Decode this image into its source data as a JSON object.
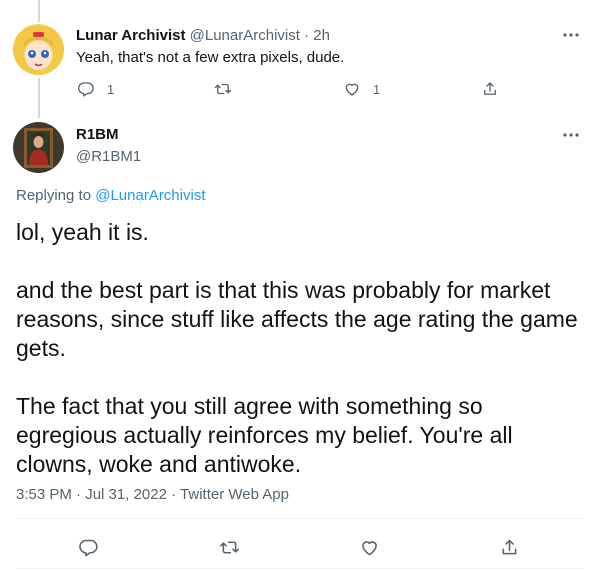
{
  "reply_tweet": {
    "display_name": "Lunar Archivist",
    "handle": "@LunarArchivist",
    "dot": "·",
    "time": "2h",
    "text": "Yeah, that's not a few extra pixels, dude.",
    "reply_count": "1",
    "like_count": "1",
    "avatar_icon": "anime-character-avatar"
  },
  "main_tweet": {
    "display_name": "R1BM",
    "handle": "@R1BM1",
    "replying_prefix": "Replying to",
    "replying_handle": "@LunarArchivist",
    "paragraphs": [
      "lol, yeah it is.",
      "and the best part is that this was probably for market reasons, since stuff like affects the age rating the game gets.",
      "The fact that you still agree with something so egregious actually reinforces my belief. You're all clowns, woke and antiwoke."
    ],
    "time": "3:53 PM",
    "date": "Jul 31, 2022",
    "source": "Twitter Web App",
    "sep": "·",
    "avatar_icon": "painting-portrait-avatar"
  },
  "colors": {
    "text": "#0f1419",
    "secondary": "#536471",
    "link": "#1d9bf0",
    "divider": "#eff3f4",
    "thread_line": "#cfd9de"
  },
  "icons": [
    "more-icon",
    "reply-icon",
    "retweet-icon",
    "like-icon",
    "share-icon"
  ]
}
